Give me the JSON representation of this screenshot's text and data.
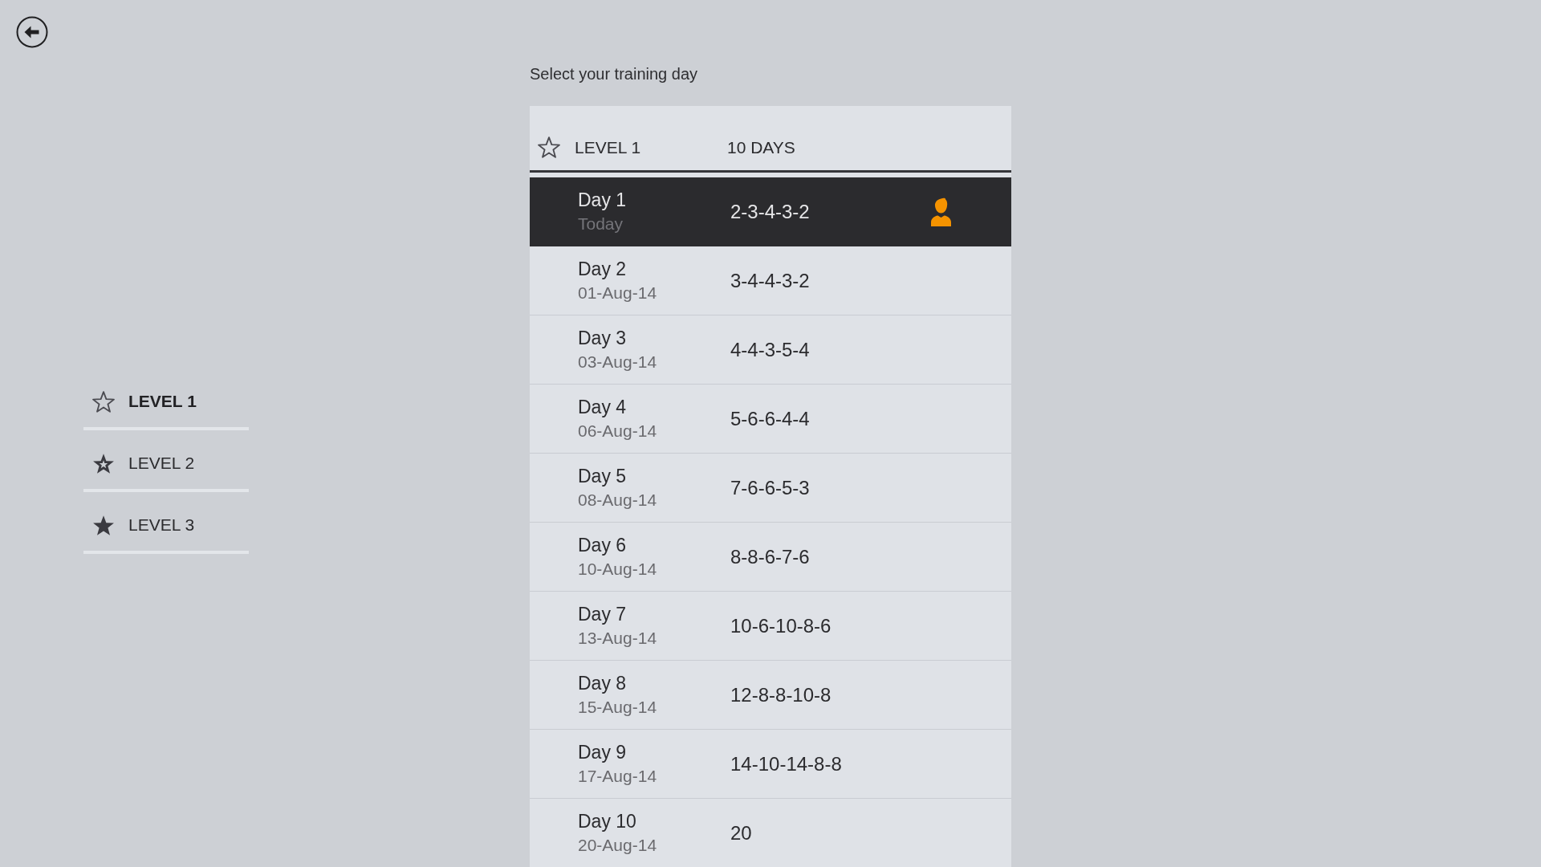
{
  "title": "Select your training day",
  "sidebar": {
    "items": [
      {
        "label": "LEVEL 1",
        "kind": "empty",
        "selected": true
      },
      {
        "label": "LEVEL 2",
        "kind": "partial",
        "selected": false
      },
      {
        "label": "LEVEL 3",
        "kind": "full",
        "selected": false
      }
    ]
  },
  "table": {
    "header": {
      "title": "LEVEL 1",
      "day_count": "10 DAYS"
    },
    "rows": [
      {
        "day": "Day 1",
        "date": "Today",
        "sequence": "2-3-4-3-2",
        "selected": true,
        "current": true
      },
      {
        "day": "Day 2",
        "date": "01-Aug-14",
        "sequence": "3-4-4-3-2",
        "selected": false,
        "current": false
      },
      {
        "day": "Day 3",
        "date": "03-Aug-14",
        "sequence": "4-4-3-5-4",
        "selected": false,
        "current": false
      },
      {
        "day": "Day 4",
        "date": "06-Aug-14",
        "sequence": "5-6-6-4-4",
        "selected": false,
        "current": false
      },
      {
        "day": "Day 5",
        "date": "08-Aug-14",
        "sequence": "7-6-6-5-3",
        "selected": false,
        "current": false
      },
      {
        "day": "Day 6",
        "date": "10-Aug-14",
        "sequence": "8-8-6-7-6",
        "selected": false,
        "current": false
      },
      {
        "day": "Day 7",
        "date": "13-Aug-14",
        "sequence": "10-6-10-8-6",
        "selected": false,
        "current": false
      },
      {
        "day": "Day 8",
        "date": "15-Aug-14",
        "sequence": "12-8-8-10-8",
        "selected": false,
        "current": false
      },
      {
        "day": "Day 9",
        "date": "17-Aug-14",
        "sequence": "14-10-14-8-8",
        "selected": false,
        "current": false
      },
      {
        "day": "Day 10",
        "date": "20-Aug-14",
        "sequence": "20",
        "selected": false,
        "current": false
      }
    ]
  }
}
